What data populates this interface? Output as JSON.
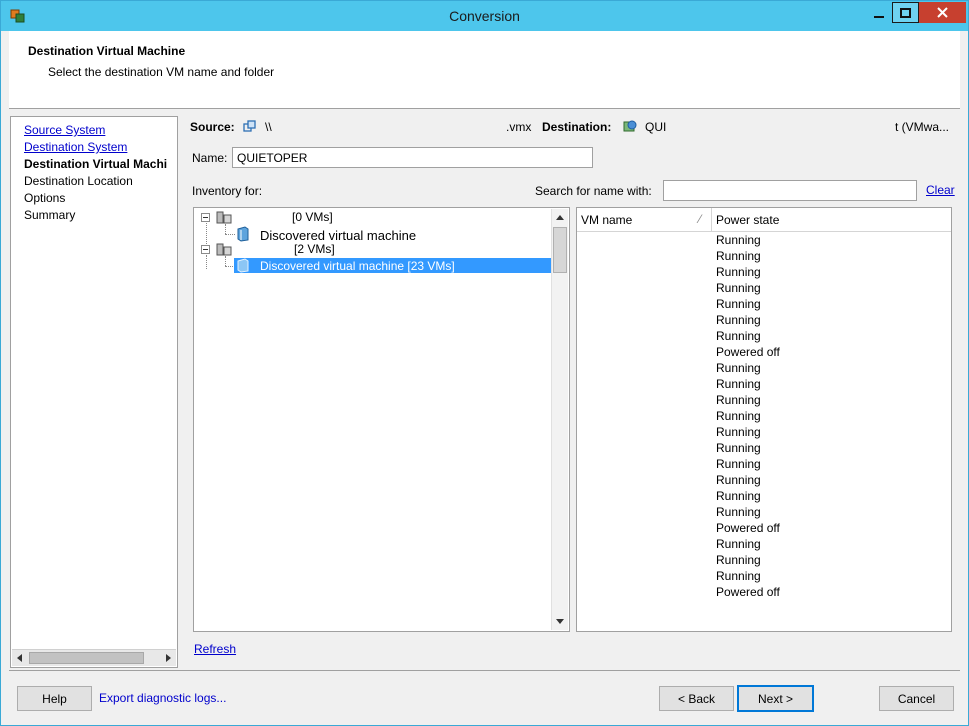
{
  "window": {
    "title": "Conversion"
  },
  "header": {
    "title": "Destination Virtual Machine",
    "subtitle": "Select the destination VM name and folder"
  },
  "nav": {
    "items": [
      {
        "label": "Source System"
      },
      {
        "label": "Destination System"
      },
      {
        "label": "Destination Virtual Machi"
      },
      {
        "label": "Destination Location"
      },
      {
        "label": "Options"
      },
      {
        "label": "Summary"
      }
    ]
  },
  "source": {
    "label": "Source:",
    "value": "\\\\",
    "ext": ".vmx"
  },
  "destination": {
    "label": "Destination:",
    "value": "QUI",
    "extra": "t (VMwa..."
  },
  "name_field": {
    "label": "Name:",
    "value": "QUIETOPER"
  },
  "inventory": {
    "label": "Inventory for:"
  },
  "search": {
    "label": "Search for name with:",
    "value": "",
    "clear": "Clear"
  },
  "tree": {
    "nodes": [
      {
        "label": "[0 VMs]"
      },
      {
        "label": "Discovered virtual machine"
      },
      {
        "label": "[2 VMs]"
      },
      {
        "label": "Discovered virtual machine [23 VMs]"
      }
    ]
  },
  "vm_table": {
    "columns": [
      "VM name",
      "Power state"
    ],
    "rows": [
      "Running",
      "Running",
      "Running",
      "Running",
      "Running",
      "Running",
      "Running",
      "Powered off",
      "Running",
      "Running",
      "Running",
      "Running",
      "Running",
      "Running",
      "Running",
      "Running",
      "Running",
      "Running",
      "Powered off",
      "Running",
      "Running",
      "Running",
      "Powered off"
    ]
  },
  "refresh": "Refresh",
  "footer": {
    "help": "Help",
    "export": "Export diagnostic logs...",
    "back": "< Back",
    "next": "Next >",
    "cancel": "Cancel"
  }
}
